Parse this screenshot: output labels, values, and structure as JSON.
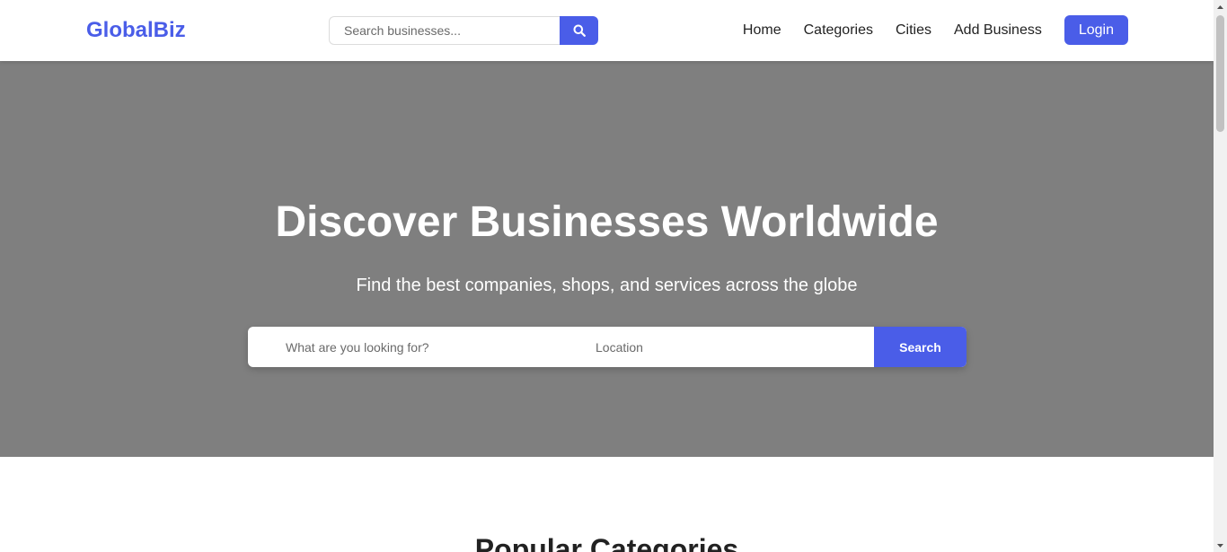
{
  "header": {
    "logo": "GlobalBiz",
    "search": {
      "placeholder": "Search businesses...",
      "icon": "search-icon"
    },
    "nav": {
      "home": "Home",
      "categories": "Categories",
      "cities": "Cities",
      "add_business": "Add Business",
      "login": "Login"
    }
  },
  "hero": {
    "title": "Discover Businesses Worldwide",
    "subtitle": "Find the best companies, shops, and services across the globe",
    "search": {
      "what_placeholder": "What are you looking for?",
      "location_placeholder": "Location",
      "button": "Search"
    }
  },
  "sections": {
    "popular_categories": "Popular Categories"
  },
  "colors": {
    "accent": "#4a5de8",
    "hero_bg": "#7f7f7f"
  }
}
